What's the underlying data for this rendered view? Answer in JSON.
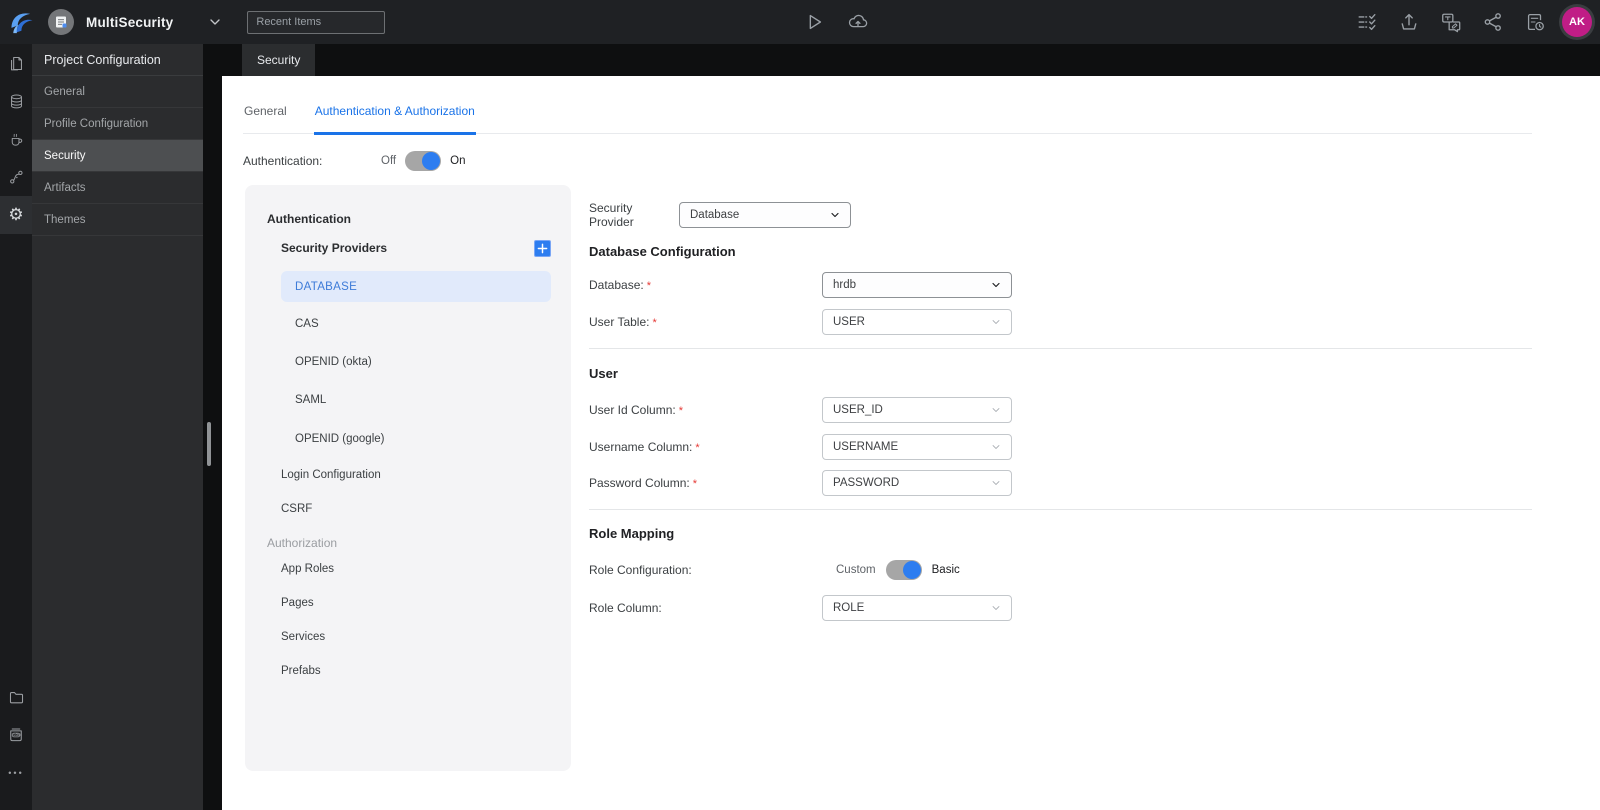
{
  "colors": {
    "accent_blue": "#2d7df0",
    "tab_active_blue": "#1a73e8",
    "avatar_bg": "#c01d86",
    "provider_selected_bg": "#e1eafb",
    "provider_selected_text": "#3d7bd8",
    "required_red": "#e53935",
    "toggle_track": "#a6a6a6",
    "toggle_knob": "#2d7df0"
  },
  "icons": {
    "gear": "⚙",
    "ellipsis": "•••",
    "log_label": "LOG"
  },
  "topbar": {
    "project_name": "MultiSecurity",
    "recent_items_placeholder": "Recent Items",
    "avatar_initials": "AK"
  },
  "project_panel": {
    "title": "Project Configuration",
    "items": [
      "General",
      "Profile Configuration",
      "Security",
      "Artifacts",
      "Themes"
    ],
    "selected": "Security"
  },
  "editor_tab": "Security",
  "tabs": {
    "general": "General",
    "auth": "Authentication & Authorization",
    "active": "Authentication & Authorization"
  },
  "auth_row": {
    "label": "Authentication:",
    "off": "Off",
    "on": "On",
    "state": "On"
  },
  "nav": {
    "section_authentication": "Authentication",
    "security_providers_label": "Security Providers",
    "providers": [
      "DATABASE",
      "CAS",
      "OPENID (okta)",
      "SAML",
      "OPENID (google)"
    ],
    "selected_provider": "DATABASE",
    "login_configuration": "Login Configuration",
    "csrf": "CSRF",
    "section_authorization": "Authorization",
    "authorization_items": [
      "App Roles",
      "Pages",
      "Services",
      "Prefabs"
    ]
  },
  "form": {
    "required_marker": "*",
    "provider": {
      "label": "Security Provider",
      "value": "Database"
    },
    "db_section": {
      "title": "Database Configuration",
      "database": {
        "label": "Database:",
        "value": "hrdb"
      },
      "user_table": {
        "label": "User Table:",
        "value": "USER"
      }
    },
    "user_section": {
      "title": "User",
      "user_id": {
        "label": "User Id Column:",
        "value": "USER_ID"
      },
      "username": {
        "label": "Username Column:",
        "value": "USERNAME"
      },
      "password": {
        "label": "Password Column:",
        "value": "PASSWORD"
      }
    },
    "role_section": {
      "title": "Role Mapping",
      "role_config": {
        "label": "Role Configuration:",
        "left": "Custom",
        "right": "Basic",
        "state": "Basic"
      },
      "role_column": {
        "label": "Role Column:",
        "value": "ROLE"
      }
    }
  }
}
